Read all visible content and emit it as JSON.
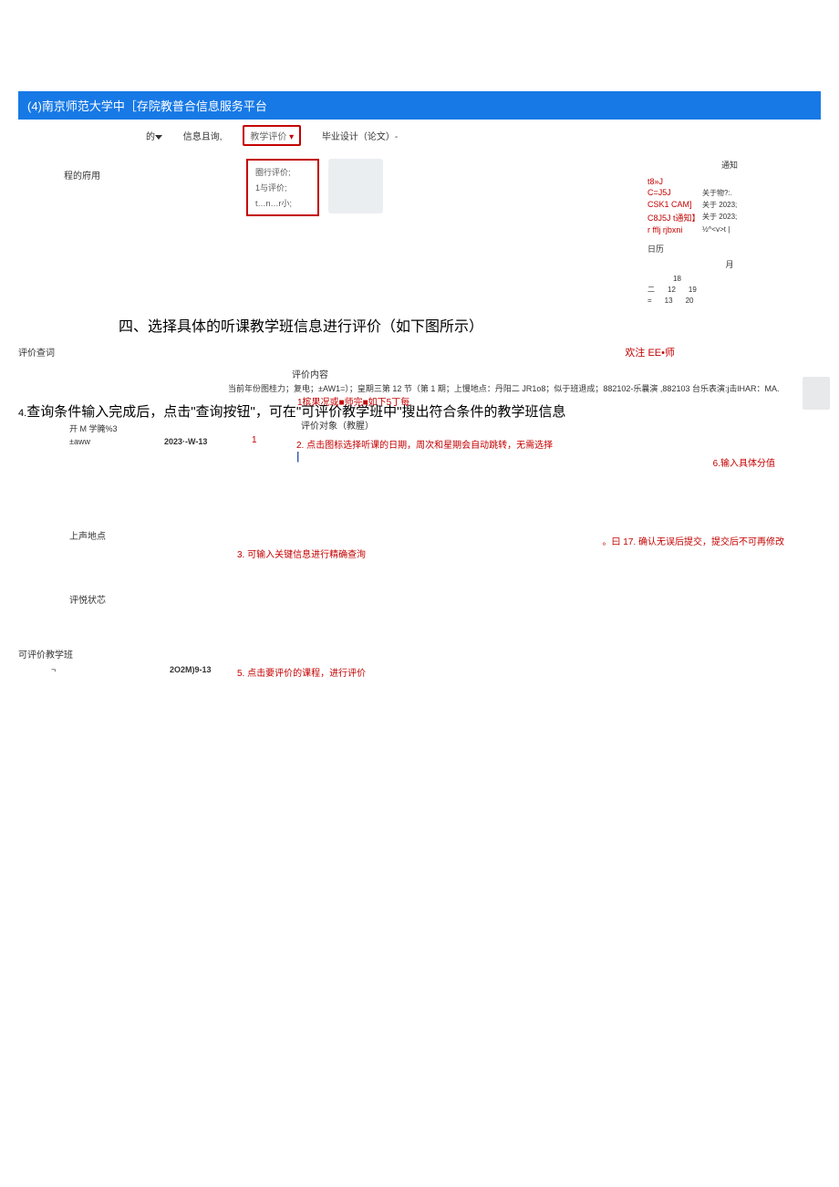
{
  "header": {
    "title": "(4)南京师范大学中［存院教普合信息服务平台"
  },
  "nav": {
    "item1": "的",
    "item2": "信息且询,",
    "dropdown_label": "教学评价",
    "item4": "毕业设计（论文）-"
  },
  "leftLabel1": "程的府用",
  "dropdownMenu": {
    "i1": "圈行评价;",
    "i2": "1与评价;",
    "i3": "t…n…r小;"
  },
  "notice": {
    "title": "通知",
    "rows": [
      {
        "code": "t8»J",
        "body": ""
      },
      {
        "code": "C=J5J",
        "body": "关于物?:."
      },
      {
        "code": "CSK1 CAM]",
        "body": "关于 2023;"
      },
      {
        "code": "C8J5J t通知】",
        "body": "关于 2023;"
      },
      {
        "code": "r fflj    rjbxni",
        "body": "½^<v>t |"
      }
    ]
  },
  "calendar": {
    "title": "日历",
    "month": "月",
    "rows": [
      {
        "a": "",
        "b": "",
        "c": "18"
      },
      {
        "a": "二",
        "b": "12",
        "c": "19"
      },
      {
        "a": "=",
        "b": "13",
        "c": "20"
      }
    ]
  },
  "sectionHeading": "四、选择具体的听课教学班信息进行评价（如下图所示）",
  "evalQuery": "评价查词",
  "welcome": "欢注 EE•师",
  "evalContentLabel": "评价内容",
  "evalContentDetail": "当前年份图桂力；复电；±AW1=）；皇期三第 12 节（第 1 期；上慢地点：丹阳二 JR1o8；似于班退成；882102-乐曩演 ,882103 台乐表演:j击lHAR：MA.",
  "kmLabel": "开 M 学腌%3",
  "instruction4_label": "4.",
  "instruction4": "查询条件输入完成后，点击\"查询按钮\"，可在\"可评价教学班中\"搜出符合条件的教学班信息",
  "inlineRed1": "1槟果况或■师完■如下5丁每",
  "evalObj": "评价对象（教腥）",
  "rowAfter4": {
    "aww": "±aww",
    "date": "2023·-W-13",
    "redNum1": "1",
    "note2": "2. 点击图标选择听课的日期，周次和星期会自动跳转，无需选择",
    "bar": "|",
    "note6": "6.输入具体分值"
  },
  "place": {
    "label": "上声地点",
    "note3": "3. 可输入关键信息进行精确查洵",
    "note7": "。曰 17. 确认无误后提交，提交后不可再修改"
  },
  "status": {
    "label": "评悦状芯"
  },
  "classRow": {
    "label": "可评价教学班",
    "neg": "¬",
    "date": "2O2M)9-13",
    "note5": "5. 点击要评价的课程，进行评价"
  }
}
